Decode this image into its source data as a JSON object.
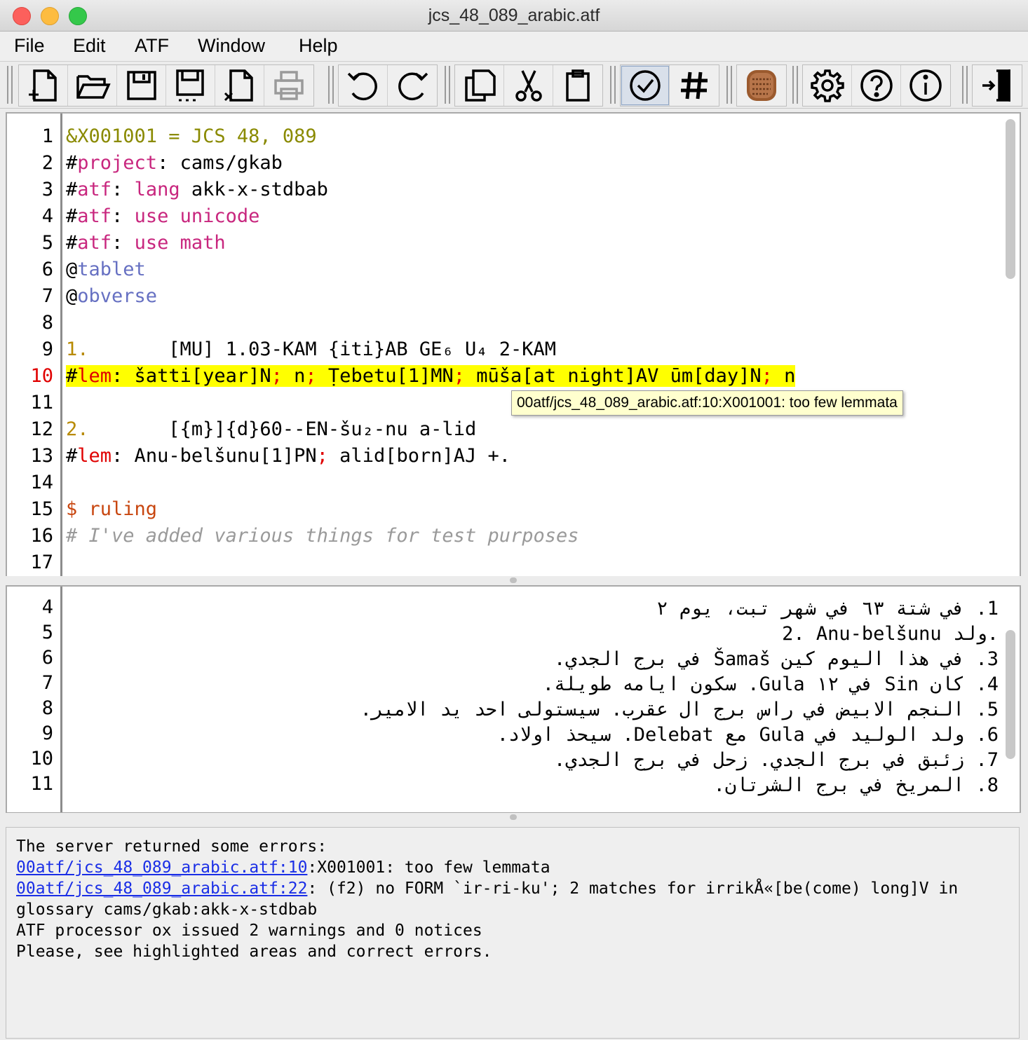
{
  "window": {
    "title": "jcs_48_089_arabic.atf"
  },
  "menu": [
    "File",
    "Edit",
    "ATF",
    "Window",
    "Help"
  ],
  "toolbar": {
    "file_group": [
      "new-file-icon",
      "open-folder-icon",
      "save-icon",
      "save-as-icon",
      "close-file-icon",
      "print-icon"
    ],
    "undo_group": [
      "undo-icon",
      "redo-icon"
    ],
    "clip_group": [
      "copy-icon",
      "cut-icon",
      "paste-icon"
    ],
    "check_group": [
      "validate-check-icon",
      "hash-lemmatise-icon"
    ],
    "tablet_group": [
      "tablet-icon"
    ],
    "help_group": [
      "settings-gear-icon",
      "help-question-icon",
      "info-icon"
    ],
    "exit_group": [
      "exit-door-icon"
    ]
  },
  "editor": {
    "line_numbers": [
      "1",
      "2",
      "3",
      "4",
      "5",
      "6",
      "7",
      "8",
      "9",
      "10",
      "11",
      "12",
      "13",
      "14",
      "15",
      "16",
      "17"
    ],
    "error_line": "10",
    "lines": {
      "l1": "&X001001 = JCS 48, 089",
      "l2a": "#",
      "l2b": "project",
      "l2c": ": cams/gkab",
      "l3a": "#",
      "l3b": "atf",
      "l3c": ": ",
      "l3d": "lang",
      "l3e": " akk-x-stdbab",
      "l4a": "#",
      "l4b": "atf",
      "l4c": ": ",
      "l4d": "use unicode",
      "l5a": "#",
      "l5b": "atf",
      "l5c": ": ",
      "l5d": "use math",
      "l6a": "@",
      "l6b": "tablet",
      "l7a": "@",
      "l7b": "obverse",
      "l9a": "1.",
      "l9b": "       [MU] 1.03-KAM {iti}AB GE₆ U₄ 2-KAM",
      "l10a": "#",
      "l10b": "lem",
      "l10c": ": šatti[year]N",
      "l10d": ";",
      "l10e": " n",
      "l10f": ";",
      "l10g": " Ṭebetu[1]MN",
      "l10h": ";",
      "l10i": " mūša[at night]AV ūm[day]N",
      "l10j": ";",
      "l10k": " n",
      "l12a": "2.",
      "l12b": "       [{m}]{d}60--EN-šu₂-nu a-lid",
      "l13a": "#",
      "l13b": "lem",
      "l13c": ": Anu-belšunu[1]PN",
      "l13d": ";",
      "l13e": " alid[born]AJ +.",
      "l15": "$ ruling",
      "l16": "# I've added various things for test purposes"
    },
    "tooltip": "00atf/jcs_48_089_arabic.atf:10:X001001: too few lemmata"
  },
  "translation": {
    "line_numbers": [
      "4",
      "5",
      "6",
      "7",
      "8",
      "9",
      "10",
      "11"
    ],
    "lines": [
      "1. في شتة ٦٣ في شهر تبت، يوم ٢",
      "2. Anu-belšunu ولد.",
      "3. في هذا اليوم كين Šamaš في برج الجدي.",
      "4. كان Sin في ١٢ Gula. سكون ايامه طويلة.",
      "5. النجم الابيض في راس برج ال عقرب. سيستولى احد يد الامير.",
      "6. ولد الوليد في Gula مع Delebat. سيحذ اولاد.",
      "7. زئبق في برج الجدي. زحل في برج الجدي.",
      "8. المريخ في برج الشرتان."
    ]
  },
  "console": {
    "header": "The server returned some errors:",
    "link1": "00atf/jcs_48_089_arabic.atf:10",
    "msg1": ":X001001: too few lemmata",
    "link2": "00atf/jcs_48_089_arabic.atf:22",
    "msg2": ": (f2) no FORM `ir-ri-ku'; 2 matches for irrikÅ«[be(come) long]V in",
    "msg2b": "glossary cams/gkab:akk-x-stdbab",
    "summary": "ATF processor ox issued 2 warnings and 0 notices",
    "advice": "Please, see highlighted areas and correct errors."
  }
}
